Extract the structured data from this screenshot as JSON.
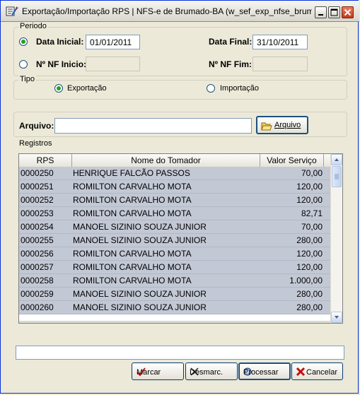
{
  "window": {
    "title": "Exportação/Importação RPS  |  NFS-e de Brumado-BA (w_sef_exp_nfse_brum...",
    "icon": "app-icon",
    "controls": [
      "minimize-icon",
      "maximize-icon",
      "close-icon"
    ]
  },
  "periodo": {
    "legend": "Periodo",
    "data_inicial_label": "Data Inicial:",
    "data_inicial_value": "01/01/2011",
    "data_final_label": "Data Final:",
    "data_final_value": "31/10/2011",
    "nf_inicio_label": "Nº NF Inicio:",
    "nf_inicio_value": "",
    "nf_fim_label": "Nº NF Fim:",
    "nf_fim_value": "",
    "selected_mode": "data"
  },
  "tipo": {
    "legend": "Tipo",
    "exportacao_label": "Exportação",
    "importacao_label": "Importação",
    "selected": "exportacao"
  },
  "arquivo": {
    "label": "Arquivo:",
    "value": "",
    "button_label": "Arquivo",
    "button_icon": "folder-open-icon"
  },
  "registros": {
    "label": "Registros",
    "columns": [
      "RPS",
      "Nome do Tomador",
      "Valor Serviço"
    ],
    "rows": [
      {
        "rps": "0000250",
        "nome": "HENRIQUE FALCÃO PASSOS",
        "valor": "70,00"
      },
      {
        "rps": "0000251",
        "nome": "ROMILTON CARVALHO MOTA",
        "valor": "120,00"
      },
      {
        "rps": "0000252",
        "nome": "ROMILTON CARVALHO MOTA",
        "valor": "120,00"
      },
      {
        "rps": "0000253",
        "nome": "ROMILTON CARVALHO MOTA",
        "valor": "82,71"
      },
      {
        "rps": "0000254",
        "nome": "MANOEL SIZINIO SOUZA JUNIOR",
        "valor": "70,00"
      },
      {
        "rps": "0000255",
        "nome": "MANOEL SIZINIO SOUZA JUNIOR",
        "valor": "280,00"
      },
      {
        "rps": "0000256",
        "nome": "ROMILTON CARVALHO MOTA",
        "valor": "120,00"
      },
      {
        "rps": "0000257",
        "nome": "ROMILTON CARVALHO MOTA",
        "valor": "120,00"
      },
      {
        "rps": "0000258",
        "nome": "ROMILTON CARVALHO MOTA",
        "valor": "1.000,00"
      },
      {
        "rps": "0000259",
        "nome": "MANOEL SIZINIO SOUZA JUNIOR",
        "valor": "280,00"
      },
      {
        "rps": "0000260",
        "nome": "MANOEL SIZINIO SOUZA JUNIOR",
        "valor": "280,00"
      }
    ]
  },
  "status": {
    "text": ""
  },
  "buttons": {
    "marcar": "Marcar",
    "desmarcar": "Desmarc.",
    "processar": "Processar",
    "cancelar": "Cancelar"
  },
  "colors": {
    "row_background": "#c3c8d5",
    "window_background": "#ece9d8",
    "cancel_icon": "#c01010"
  }
}
